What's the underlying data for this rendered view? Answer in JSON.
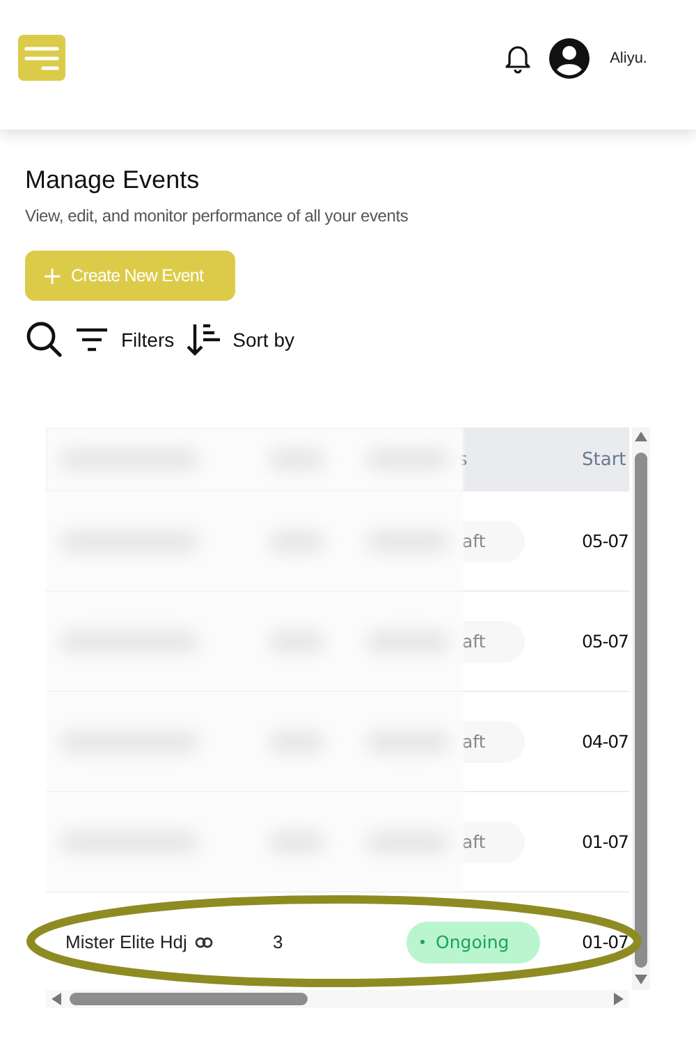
{
  "topbar": {
    "user_name": "Aliyu."
  },
  "page": {
    "title": "Manage Events",
    "subtitle": "View, edit, and monitor performance of all your events",
    "create_button": "Create New Event",
    "filters_label": "Filters",
    "sort_label": "Sort by"
  },
  "table": {
    "header_blurred": true,
    "columns": [
      {
        "label": "s"
      },
      {
        "label": "Start"
      }
    ],
    "rows": [
      {
        "blurred": true,
        "status": "aft",
        "kind": "draft",
        "start": "05-07"
      },
      {
        "blurred": true,
        "status": "aft",
        "kind": "draft",
        "start": "05-07"
      },
      {
        "blurred": true,
        "status": "aft",
        "kind": "draft",
        "start": "04-07"
      },
      {
        "blurred": true,
        "status": "aft",
        "kind": "draft",
        "start": "01-07"
      },
      {
        "blurred": false,
        "name": "Mister Elite Hdj",
        "count": "3",
        "status": "Ongoing",
        "kind": "ongoing",
        "start": "01-07",
        "highlighted": true
      }
    ]
  }
}
